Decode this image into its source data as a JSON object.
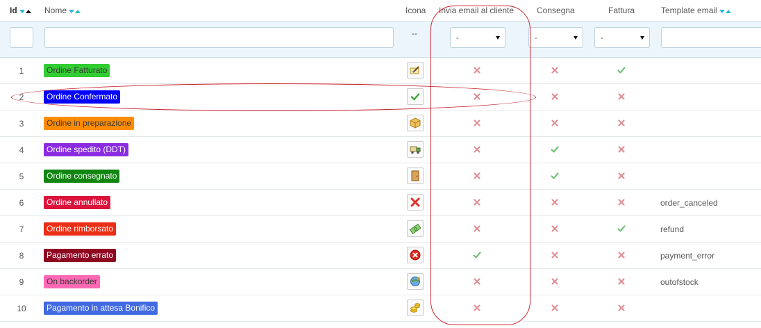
{
  "header": {
    "id": "Id",
    "name": "Nome",
    "icon": "Icona",
    "send_email": "Invia email al cliente",
    "delivery": "Consegna",
    "invoice": "Fattura",
    "template": "Template email"
  },
  "filters": {
    "icon_placeholder": "--",
    "send_email_value": "-",
    "delivery_value": "-",
    "invoice_value": "-"
  },
  "colors": {
    "check": "#72c279",
    "cross": "#e08f95",
    "accent": "#25b9d7",
    "annotation": "#c8232c"
  },
  "rows": [
    {
      "id": "1",
      "name": "Ordine Fatturato",
      "badge_bg": "#32cd32",
      "badge_fg": "#383838",
      "icon": "invoice-pen-icon",
      "send_email": false,
      "delivery": false,
      "invoice": true,
      "template": ""
    },
    {
      "id": "2",
      "name": "Ordine Confermato",
      "badge_bg": "#0000ff",
      "badge_fg": "#ffffff",
      "icon": "check-icon",
      "send_email": false,
      "delivery": false,
      "invoice": false,
      "template": ""
    },
    {
      "id": "3",
      "name": "Ordine in preparazione",
      "badge_bg": "#ff8c00",
      "badge_fg": "#383838",
      "icon": "package-icon",
      "send_email": false,
      "delivery": false,
      "invoice": false,
      "template": ""
    },
    {
      "id": "4",
      "name": "Ordine spedito (DDT)",
      "badge_bg": "#8a2be2",
      "badge_fg": "#ffffff",
      "icon": "truck-icon",
      "send_email": false,
      "delivery": true,
      "invoice": false,
      "template": ""
    },
    {
      "id": "5",
      "name": "Ordine consegnato",
      "badge_bg": "#108510",
      "badge_fg": "#ffffff",
      "icon": "door-icon",
      "send_email": false,
      "delivery": true,
      "invoice": false,
      "template": ""
    },
    {
      "id": "6",
      "name": "Ordine annullato",
      "badge_bg": "#dc143c",
      "badge_fg": "#ffffff",
      "icon": "red-x-icon",
      "send_email": false,
      "delivery": false,
      "invoice": false,
      "template": "order_canceled"
    },
    {
      "id": "7",
      "name": "Ordine rimborsato",
      "badge_bg": "#ec2e15",
      "badge_fg": "#ffffff",
      "icon": "money-icon",
      "send_email": false,
      "delivery": false,
      "invoice": true,
      "template": "refund"
    },
    {
      "id": "8",
      "name": "Pagamento errato",
      "badge_bg": "#8f0621",
      "badge_fg": "#ffffff",
      "icon": "error-circle-icon",
      "send_email": true,
      "delivery": false,
      "invoice": false,
      "template": "payment_error"
    },
    {
      "id": "9",
      "name": "On backorder",
      "badge_bg": "#ff69b4",
      "badge_fg": "#383838",
      "icon": "refresh-globe-icon",
      "send_email": false,
      "delivery": false,
      "invoice": false,
      "template": "outofstock"
    },
    {
      "id": "10",
      "name": "Pagamento in attesa Bonifico",
      "badge_bg": "#4169e1",
      "badge_fg": "#ffffff",
      "icon": "coins-icon",
      "send_email": false,
      "delivery": false,
      "invoice": false,
      "template": ""
    }
  ]
}
